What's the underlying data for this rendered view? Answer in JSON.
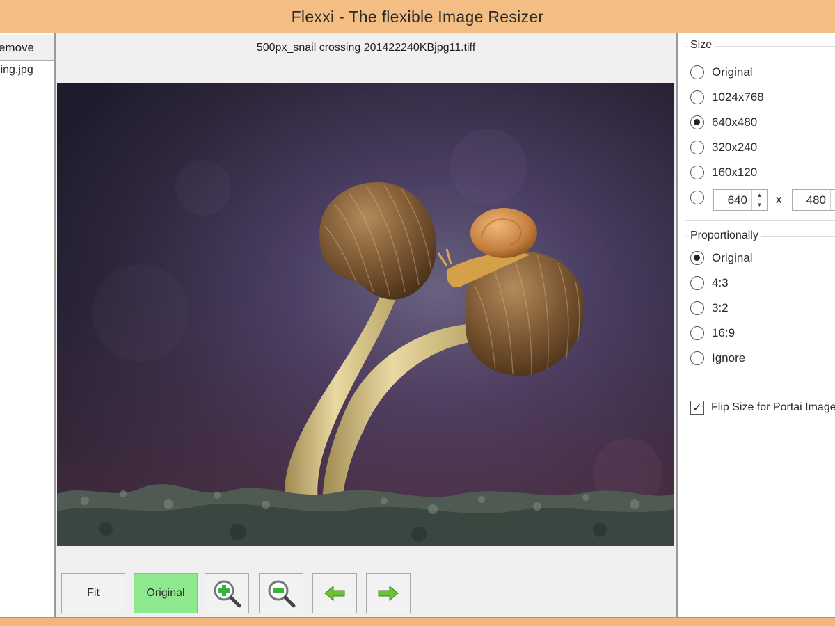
{
  "window": {
    "title": "Flexxi - The flexible Image Resizer"
  },
  "file_list": {
    "remove_label": "Remove",
    "items": [
      "snail crossing.jpg"
    ]
  },
  "viewer": {
    "filename": "500px_snail crossing 201422240KBjpg11.tiff"
  },
  "toolbar": {
    "fit_label": "Fit",
    "original_label": "Original",
    "zoom_in": "zoom-in-icon",
    "zoom_out": "zoom-out-icon",
    "prev": "arrow-left-icon",
    "next": "arrow-right-icon",
    "active_color": "#8ee88e"
  },
  "size": {
    "title": "Size",
    "options": [
      "Original",
      "1024x768",
      "640x480",
      "320x240",
      "160x120"
    ],
    "selected": "640x480",
    "custom_width": "640",
    "custom_height": "480",
    "separator": "x"
  },
  "proportion": {
    "title": "Proportionally",
    "options": [
      "Original",
      "4:3",
      "3:2",
      "16:9",
      "Ignore"
    ],
    "selected": "Original"
  },
  "flip": {
    "label": "Flip Size for Portai Images",
    "checked": true
  }
}
